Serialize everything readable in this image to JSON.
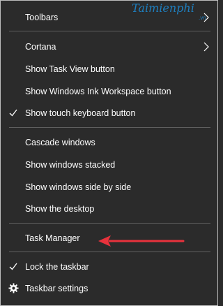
{
  "watermark": {
    "text": "Taimienphi",
    "suffix": ".vn"
  },
  "menu": {
    "items": [
      {
        "label": "Toolbars",
        "submenu": true
      },
      {
        "label": "Cortana",
        "submenu": true
      },
      {
        "label": "Show Task View button"
      },
      {
        "label": "Show Windows Ink Workspace button"
      },
      {
        "label": "Show touch keyboard button",
        "checked": true
      },
      {
        "label": "Cascade windows"
      },
      {
        "label": "Show windows stacked"
      },
      {
        "label": "Show windows side by side"
      },
      {
        "label": "Show the desktop"
      },
      {
        "label": "Task Manager",
        "highlighted_by": "arrow-icon"
      },
      {
        "label": "Lock the taskbar",
        "checked": true
      },
      {
        "label": "Taskbar settings",
        "icon": "gear-icon"
      }
    ]
  },
  "colors": {
    "background": "#2b2b2b",
    "text": "#ffffff",
    "separator": "#5f5f5f",
    "arrow": "#e8323c",
    "watermark": "#1e7fbf"
  }
}
